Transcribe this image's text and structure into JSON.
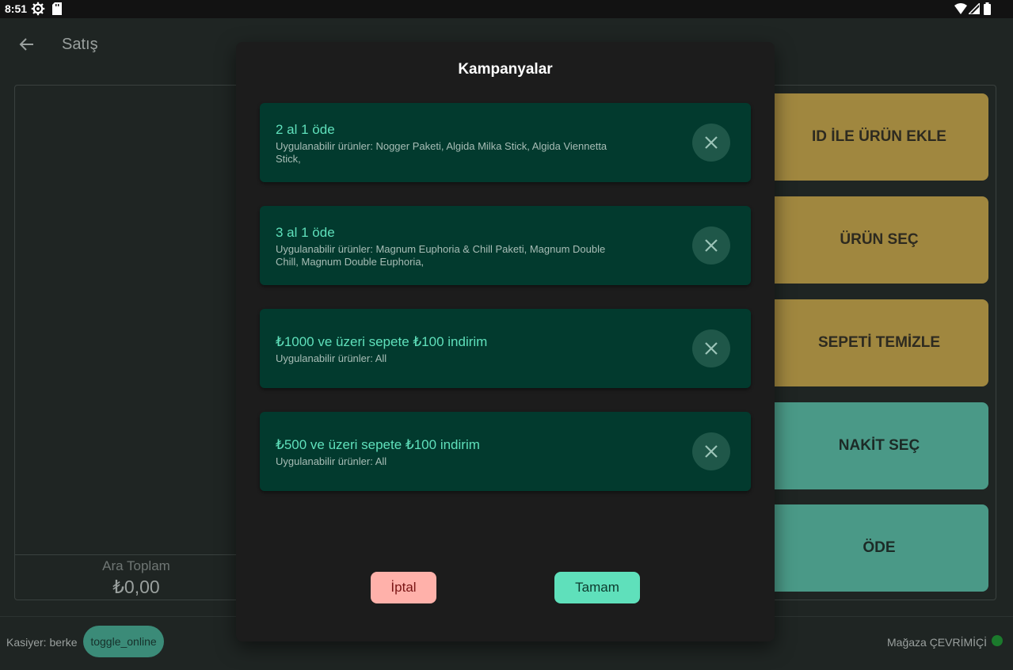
{
  "status_bar": {
    "time": "8:51",
    "icons": [
      "gear-icon",
      "sd-card-icon",
      "wifi-icon",
      "signal-icon",
      "battery-icon"
    ]
  },
  "app_bar": {
    "title": "Satış",
    "back_icon": "arrow-left-icon"
  },
  "cart": {
    "subtotal_label": "Ara Toplam",
    "subtotal_value": "₺0,00"
  },
  "actions": {
    "add_by_id": "ID İLE ÜRÜN EKLE",
    "select_product": "ÜRÜN SEÇ",
    "clear_cart": "SEPETİ TEMİZLE",
    "select_cash": "NAKİT SEÇ",
    "pay": "ÖDE"
  },
  "bottom_bar": {
    "cashier": "Kasiyer: berke",
    "toggle_label": "toggle_online",
    "store_status": "Mağaza ÇEVRİMİÇİ",
    "status_color": "#1b7a2c"
  },
  "dialog": {
    "title": "Kampanyalar",
    "campaigns": [
      {
        "title": "2 al 1 öde",
        "description": "Uygulanabilir ürünler: Nogger Paketi, Algida Milka Stick, Algida Viennetta Stick,"
      },
      {
        "title": "3 al 1 öde",
        "description": "Uygulanabilir ürünler: Magnum Euphoria & Chill Paketi, Magnum Double Chill, Magnum Double Euphoria,"
      },
      {
        "title": "₺1000 ve üzeri sepete ₺100 indirim",
        "description": "Uygulanabilir ürünler: All"
      },
      {
        "title": "₺500 ve üzeri sepete ₺100 indirim",
        "description": "Uygulanabilir ürünler: All"
      }
    ],
    "cancel_label": "İptal",
    "ok_label": "Tamam"
  },
  "colors": {
    "accent_gold": "#a0873f",
    "accent_teal": "#4a9987",
    "campaign_bg": "#023a2e",
    "campaign_title": "#5fe0bb",
    "cancel_bg": "#ffb1aa",
    "ok_bg": "#5fe0bb"
  }
}
